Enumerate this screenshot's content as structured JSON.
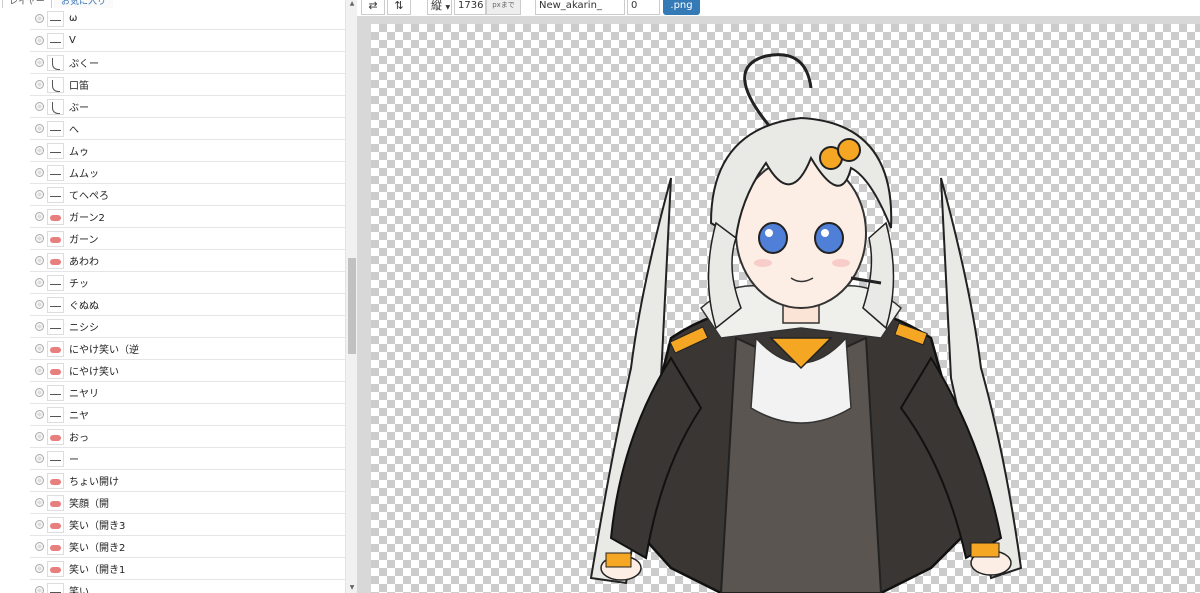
{
  "tabs": {
    "layers": "レイヤー",
    "favorites": "お気に入り"
  },
  "layers": [
    {
      "label": "ω",
      "thumb": "line"
    },
    {
      "label": "V",
      "thumb": "line"
    },
    {
      "label": "ぷくー",
      "thumb": "curve"
    },
    {
      "label": "口笛",
      "thumb": "curve"
    },
    {
      "label": "ぶー",
      "thumb": "curve"
    },
    {
      "label": "へ",
      "thumb": "line"
    },
    {
      "label": "ムゥ",
      "thumb": "line"
    },
    {
      "label": "ムムッ",
      "thumb": "line"
    },
    {
      "label": "てへぺろ",
      "thumb": "line"
    },
    {
      "label": "ガーン2",
      "thumb": "pink"
    },
    {
      "label": "ガーン",
      "thumb": "pink"
    },
    {
      "label": "あわわ",
      "thumb": "pink"
    },
    {
      "label": "チッ",
      "thumb": "line"
    },
    {
      "label": "ぐぬぬ",
      "thumb": "line"
    },
    {
      "label": "ニシシ",
      "thumb": "line"
    },
    {
      "label": "にやけ笑い（逆",
      "thumb": "pink"
    },
    {
      "label": "にやけ笑い",
      "thumb": "pink"
    },
    {
      "label": "ニヤリ",
      "thumb": "line"
    },
    {
      "label": "ニヤ",
      "thumb": "line"
    },
    {
      "label": "おっ",
      "thumb": "pink"
    },
    {
      "label": "ー",
      "thumb": "line"
    },
    {
      "label": "ちょい開け",
      "thumb": "pink"
    },
    {
      "label": "笑顔（開",
      "thumb": "pink"
    },
    {
      "label": "笑い（開き3",
      "thumb": "pink"
    },
    {
      "label": "笑い（開き2",
      "thumb": "pink"
    },
    {
      "label": "笑い（開き1",
      "thumb": "pink"
    },
    {
      "label": "笑い",
      "thumb": "line"
    }
  ],
  "toolbar": {
    "flip_h_icon": "⇄",
    "flip_v_icon": "⇅",
    "orientation": "縦",
    "size_value": "1736",
    "size_unit": "pxまで",
    "filename": "New_akarin_",
    "number": "0",
    "export_label": ".png"
  },
  "scrollbar": {
    "up": "▲",
    "down": "▼"
  },
  "colors": {
    "accent": "#337ab7",
    "hair": "#e9e9e6",
    "jacket": "#3a3633",
    "dress": "#5a5550",
    "eyes": "#4f7fd6",
    "ornament": "#f5a623"
  }
}
